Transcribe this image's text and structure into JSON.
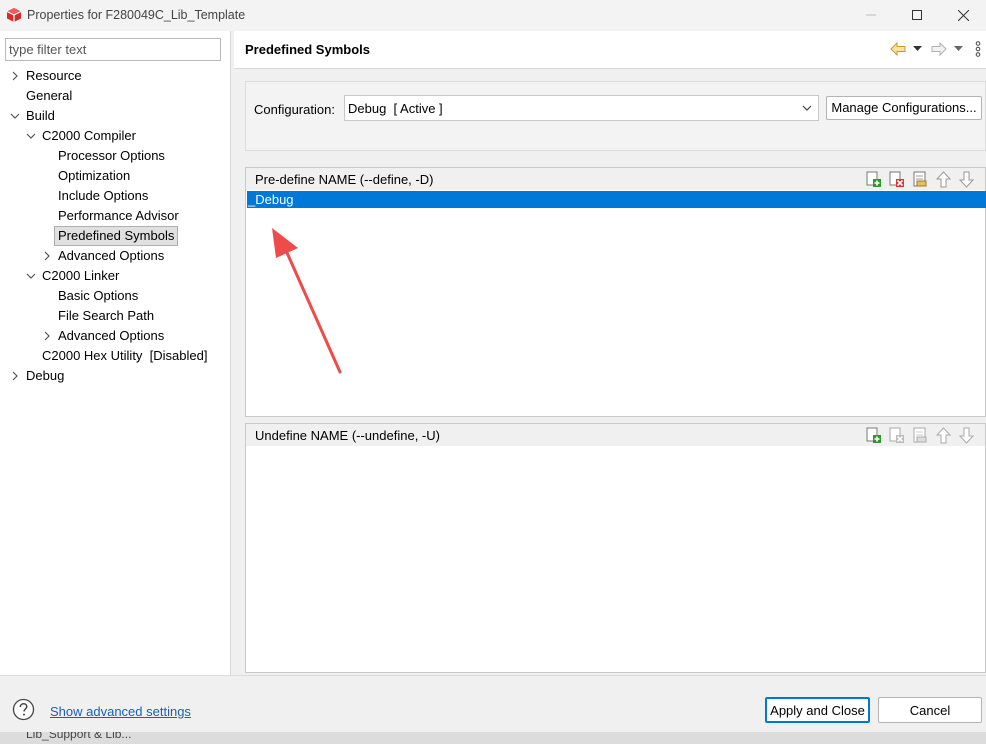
{
  "window": {
    "title": "Properties for F280049C_Lib_Template",
    "app_icon": "ccs-cube-icon",
    "controls": [
      "minimize-icon",
      "maximize-icon",
      "close-icon"
    ]
  },
  "filter": {
    "placeholder": "type filter text",
    "value": ""
  },
  "tree": {
    "resource": "Resource",
    "general": "General",
    "build": "Build",
    "c2000_compiler": "C2000 Compiler",
    "processor_options": "Processor Options",
    "optimization": "Optimization",
    "include_options": "Include Options",
    "performance_advisor": "Performance Advisor",
    "predefined_symbols": "Predefined Symbols",
    "compiler_advanced_options": "Advanced Options",
    "c2000_linker": "C2000 Linker",
    "basic_options": "Basic Options",
    "file_search_path": "File Search Path",
    "linker_advanced_options": "Advanced Options",
    "hex_utility": "C2000 Hex Utility  [Disabled]",
    "debug": "Debug",
    "selected": "Predefined Symbols"
  },
  "page": {
    "title": "Predefined Symbols",
    "nav_icons": [
      "back-arrow-icon",
      "chevron-down-icon",
      "forward-arrow-icon",
      "chevron-down-icon",
      "vertical-dots-icon"
    ]
  },
  "configuration": {
    "label": "Configuration:",
    "selected": "Debug  [ Active ]",
    "manage_button": "Manage Configurations..."
  },
  "predefine": {
    "title": "Pre-define NAME (--define, -D)",
    "items": [
      "_Debug"
    ],
    "selected_index": 0,
    "tools": [
      "add-icon",
      "delete-icon",
      "edit-icon",
      "move-up-icon",
      "move-down-icon"
    ]
  },
  "undefine": {
    "title": "Undefine NAME (--undefine, -U)",
    "items": [],
    "tools": [
      "add-icon",
      "delete-icon",
      "edit-icon",
      "move-up-icon",
      "move-down-icon"
    ]
  },
  "footer": {
    "help_icon": "help-circle-icon",
    "advanced_link": "Show advanced settings",
    "apply_button": "Apply and Close",
    "cancel_button": "Cancel"
  },
  "colors": {
    "selection": "#0078d7",
    "annotation_arrow": "#ef4b4b",
    "link": "#1a5fb4"
  },
  "taskbar": {
    "text": "Lib_Support & Lib..."
  }
}
